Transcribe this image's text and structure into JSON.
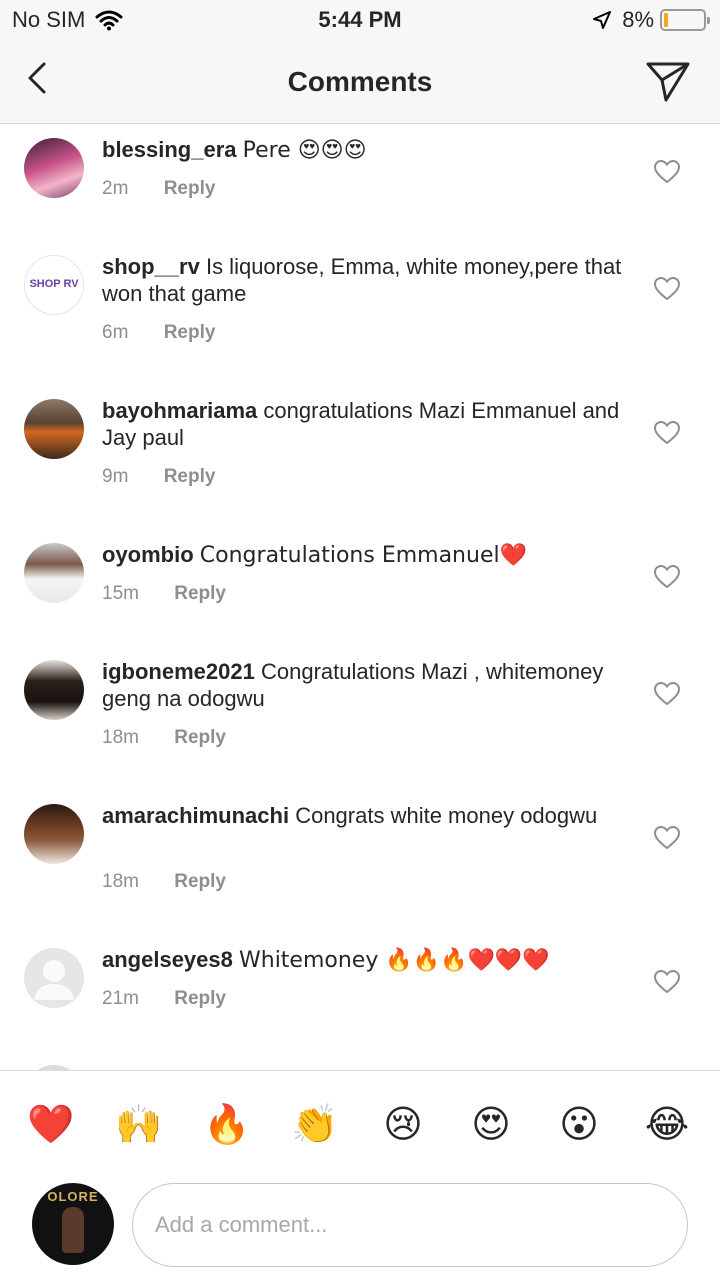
{
  "status_bar": {
    "carrier": "No SIM",
    "time": "5:44 PM",
    "battery": "8%",
    "battery_level": 0.08
  },
  "header": {
    "title": "Comments",
    "back_icon": "chevron-left-icon",
    "send_icon": "paper-plane-icon"
  },
  "comments": [
    {
      "username": "blessing_era",
      "text": "Pere 😍😍😍",
      "time": "2m",
      "reply": "Reply"
    },
    {
      "username": "shop__rv",
      "text": "Is liquorose, Emma, white money,pere that won that game",
      "time": "6m",
      "reply": "Reply"
    },
    {
      "username": "bayohmariama",
      "text": "congratulations Mazi Emmanuel and Jay paul",
      "time": "9m",
      "reply": "Reply"
    },
    {
      "username": "oyombio",
      "text": "Congratulations Emmanuel❤️",
      "time": "15m",
      "reply": "Reply"
    },
    {
      "username": "igboneme2021",
      "text": "Congratulations Mazi , whitemoney geng na odogwu",
      "time": "18m",
      "reply": "Reply"
    },
    {
      "username": "amarachimunachi",
      "text": "Congrats white money odogwu",
      "time": "18m",
      "reply": "Reply"
    },
    {
      "username": "angelseyes8",
      "text": "Whitemoney 🔥🔥🔥❤️❤️❤️",
      "time": "21m",
      "reply": "Reply"
    }
  ],
  "avatar_logo_text": "SHOP RV",
  "reactions": [
    "❤️",
    "🙌",
    "🔥",
    "👏",
    "😢",
    "😍",
    "😮",
    "😂"
  ],
  "composer": {
    "placeholder": "Add a comment...",
    "profile_logo_text": "OLORE"
  },
  "colors": {
    "text": "#262626",
    "meta": "#8e8e8e",
    "divider": "#dbdbdb",
    "bar_bg": "#f7f7f7"
  }
}
